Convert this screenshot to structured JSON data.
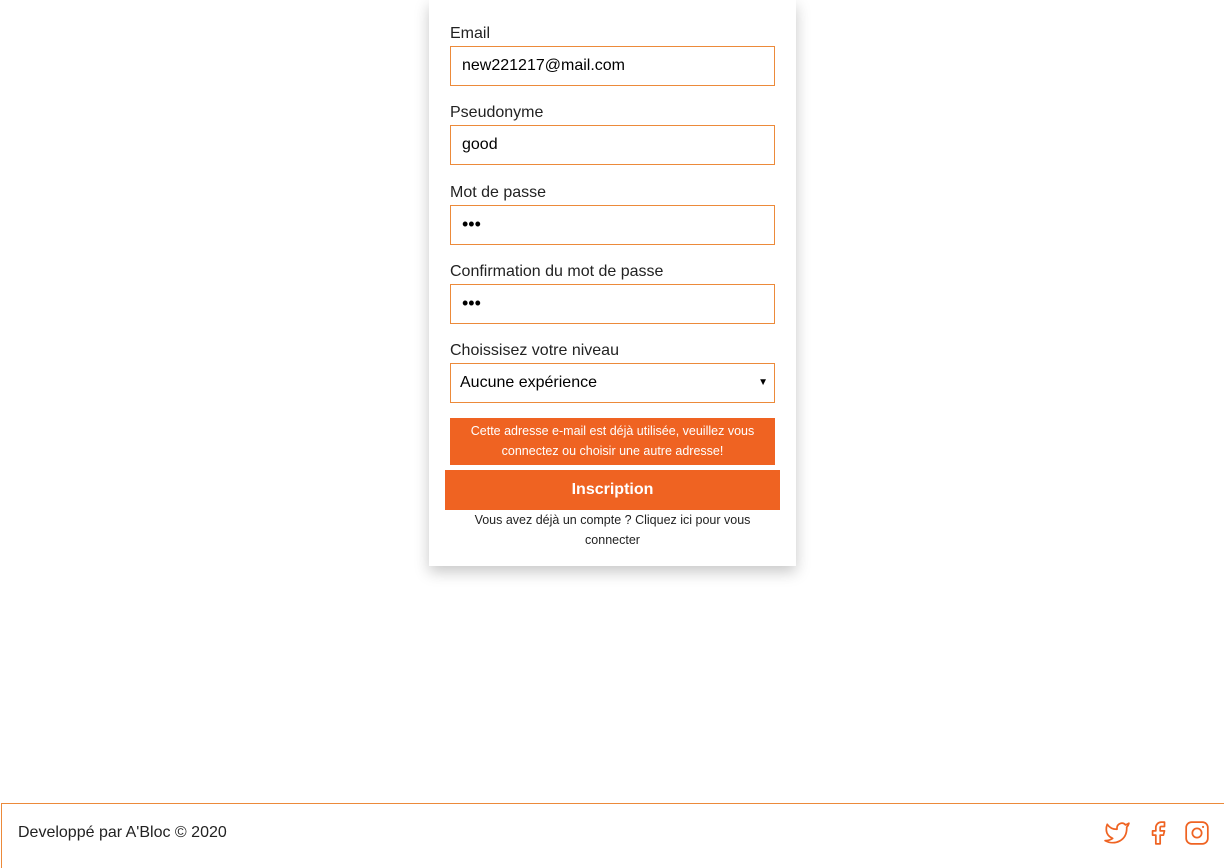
{
  "form": {
    "email": {
      "label": "Email",
      "value": "new221217@mail.com"
    },
    "pseudonym": {
      "label": "Pseudonyme",
      "value": "good"
    },
    "password": {
      "label": "Mot de passe",
      "value": "•••"
    },
    "password_confirm": {
      "label": "Confirmation du mot de passe",
      "value": "•••"
    },
    "level": {
      "label": "Choissisez votre niveau",
      "selected": "Aucune expérience"
    },
    "error_message": "Cette adresse e-mail est déjà utilisée, veuillez vous connectez ou choisir une autre adresse!",
    "submit_label": "Inscription",
    "login_link": "Vous avez déjà un compte ? Cliquez ici pour vous connecter"
  },
  "footer": {
    "copyright": "Developpé par A'Bloc © 2020",
    "social": [
      "twitter-icon",
      "facebook-icon",
      "instagram-icon"
    ]
  },
  "colors": {
    "accent": "#ef6322",
    "border": "#ec8a3a"
  }
}
